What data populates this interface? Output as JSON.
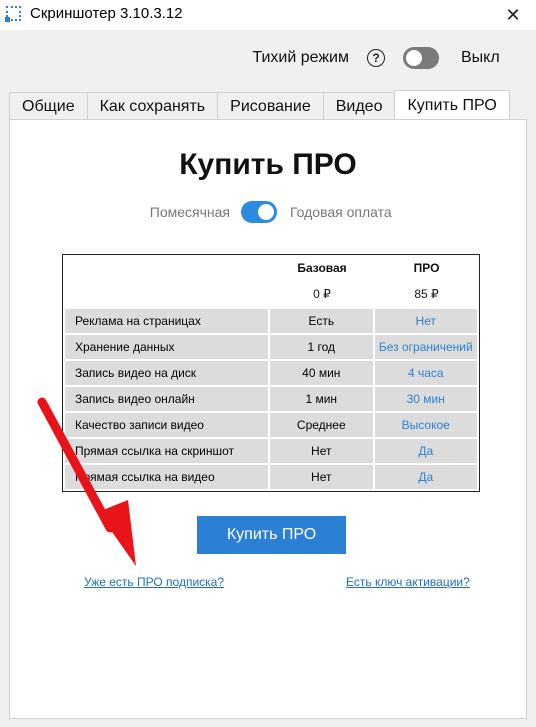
{
  "window": {
    "title": "Скриншотер 3.10.3.12",
    "close_glyph": "✕"
  },
  "header": {
    "quiet_label": "Тихий режим",
    "help_glyph": "?",
    "quiet_state": "Выкл"
  },
  "tabs": [
    {
      "label": "Общие"
    },
    {
      "label": "Как сохранять"
    },
    {
      "label": "Рисование"
    },
    {
      "label": "Видео"
    },
    {
      "label": "Купить ПРО",
      "active": true
    }
  ],
  "main": {
    "title": "Купить ПРО",
    "billing": {
      "monthly": "Помесячная",
      "yearly": "Годовая оплата",
      "yearly_selected": true
    },
    "pricing": {
      "columns": [
        "Базовая",
        "ПРО"
      ],
      "prices": [
        "0 ₽",
        "85 ₽"
      ],
      "rows": [
        {
          "feature": "Реклама на страницах",
          "basic": "Есть",
          "pro": "Нет"
        },
        {
          "feature": "Хранение данных",
          "basic": "1 год",
          "pro": "Без ограничений"
        },
        {
          "feature": "Запись видео на диск",
          "basic": "40 мин",
          "pro": "4 часа"
        },
        {
          "feature": "Запись видео онлайн",
          "basic": "1 мин",
          "pro": "30 мин"
        },
        {
          "feature": "Качество записи видео",
          "basic": "Среднее",
          "pro": "Высокое"
        },
        {
          "feature": "Прямая ссылка на скриншот",
          "basic": "Нет",
          "pro": "Да"
        },
        {
          "feature": "Прямая ссылка на видео",
          "basic": "Нет",
          "pro": "Да"
        }
      ]
    },
    "buy_button": "Купить ПРО",
    "link_subscription": "Уже есть ПРО подписка?",
    "link_activation": "Есть ключ активации?"
  },
  "colors": {
    "accent": "#2b7fd4",
    "pro_text": "#2f80d0",
    "annotation_arrow": "#e8141a"
  }
}
